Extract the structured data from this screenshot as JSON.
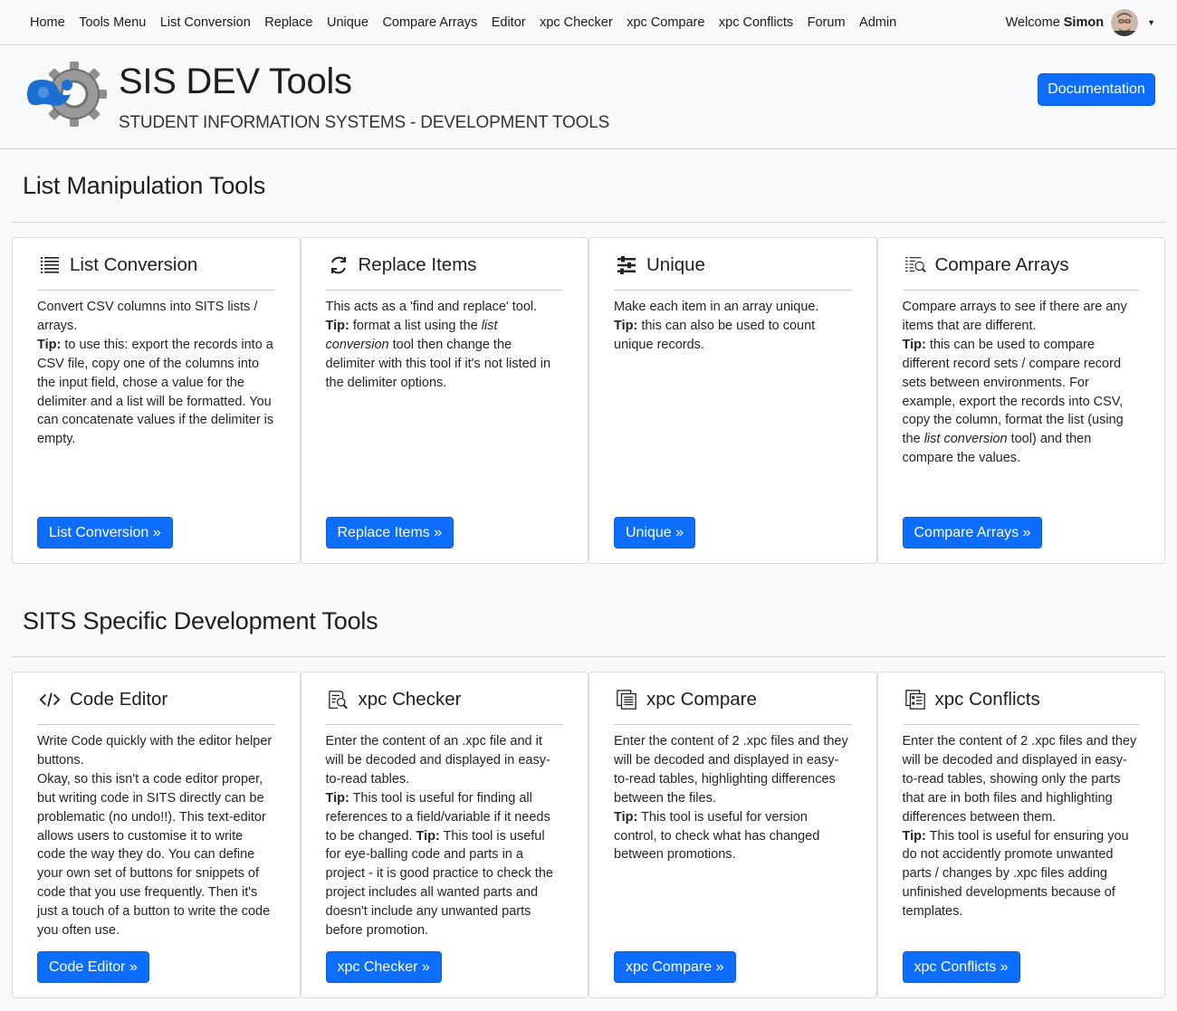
{
  "nav": {
    "links": [
      "Home",
      "Tools Menu",
      "List Conversion",
      "Replace",
      "Unique",
      "Compare Arrays",
      "Editor",
      "xpc Checker",
      "xpc Compare",
      "xpc Conflicts",
      "Forum",
      "Admin"
    ],
    "welcome": "Welcome",
    "user": "Simon"
  },
  "header": {
    "title": "SIS DEV Tools",
    "subtitle": "STUDENT INFORMATION SYSTEMS - DEVELOPMENT TOOLS",
    "doc_button": "Documentation"
  },
  "colors": {
    "primary": "#0d6efd",
    "logo_blue": "#1a6fd1",
    "logo_gray": "#8a8a8a"
  },
  "sections": [
    {
      "title": "List Manipulation Tools",
      "cards": [
        {
          "icon": "list-icon",
          "title": "List Conversion",
          "body": [
            {
              "t": "Convert CSV columns into SITS lists / arrays."
            },
            {
              "br": true
            },
            {
              "b": "Tip:"
            },
            {
              "t": " to use this: export the records into a CSV file, copy one of the columns into the input field, chose a value for the delimiter and a list will be formatted. You can concatenate values if the delimiter is empty."
            }
          ],
          "button": "List Conversion »"
        },
        {
          "icon": "refresh-icon",
          "title": "Replace Items",
          "body": [
            {
              "t": "This acts as a 'find and replace' tool."
            },
            {
              "br": true
            },
            {
              "b": "Tip:"
            },
            {
              "t": " format a list using the "
            },
            {
              "i": "list conversion"
            },
            {
              "t": " tool then change the delimiter with this tool if it's not listed in the delimiter options."
            }
          ],
          "button": "Replace Items »"
        },
        {
          "icon": "sliders-icon",
          "title": "Unique",
          "body": [
            {
              "t": "Make each item in an array unique."
            },
            {
              "br": true
            },
            {
              "b": "Tip:"
            },
            {
              "t": " this can also be used to count unique records."
            }
          ],
          "button": "Unique »"
        },
        {
          "icon": "compare-search-icon",
          "title": "Compare Arrays",
          "body": [
            {
              "t": "Compare arrays to see if there are any items that are different."
            },
            {
              "br": true
            },
            {
              "b": "Tip:"
            },
            {
              "t": " this can be used to compare different record sets / compare record sets between environments. For example, export the records into CSV, copy the column, format the list (using the "
            },
            {
              "i": "list conversion"
            },
            {
              "t": " tool) and then compare the values."
            }
          ],
          "button": "Compare Arrays »"
        }
      ]
    },
    {
      "title": "SITS Specific Development Tools",
      "cards": [
        {
          "icon": "code-icon",
          "title": "Code Editor",
          "body": [
            {
              "t": "Write Code quickly with the editor helper buttons."
            },
            {
              "br": true
            },
            {
              "t": "Okay, so this isn't a code editor proper, but writing code in SITS directly can be problematic (no undo!!). This text-editor allows users to customise it to write code the way they do. You can define your own set of buttons for snippets of code that you use frequently. Then it's just a touch of a button to write the code you often use."
            }
          ],
          "button": "Code Editor »"
        },
        {
          "icon": "file-search-icon",
          "title": "xpc Checker",
          "body": [
            {
              "t": "Enter the content of an .xpc file and it will be decoded and displayed in easy-to-read tables."
            },
            {
              "br": true
            },
            {
              "b": "Tip:"
            },
            {
              "t": " This tool is useful for finding all references to a field/variable if it needs to be changed. "
            },
            {
              "b": "Tip:"
            },
            {
              "t": " This tool is useful for eye-balling code and parts in a project - it is good practice to check the project includes all wanted parts and doesn't include any unwanted parts before promotion."
            }
          ],
          "button": "xpc Checker »"
        },
        {
          "icon": "file-compare-icon",
          "title": "xpc Compare",
          "body": [
            {
              "t": "Enter the content of 2 .xpc files and they will be decoded and displayed in easy-to-read tables, highlighting differences between the files."
            },
            {
              "br": true
            },
            {
              "b": "Tip:"
            },
            {
              "t": " This tool is useful for version control, to check what has changed between promotions."
            }
          ],
          "button": "xpc Compare »"
        },
        {
          "icon": "file-conflict-icon",
          "title": "xpc Conflicts",
          "body": [
            {
              "t": "Enter the content of 2 .xpc files and they will be decoded and displayed in easy-to-read tables, showing only the parts that are in both files and highlighting differences between them."
            },
            {
              "br": true
            },
            {
              "b": "Tip:"
            },
            {
              "t": " This tool is useful for ensuring you do not accidently promote unwanted parts / changes by .xpc files adding unfinished developments because of templates."
            }
          ],
          "button": "xpc Conflicts »"
        }
      ]
    }
  ]
}
